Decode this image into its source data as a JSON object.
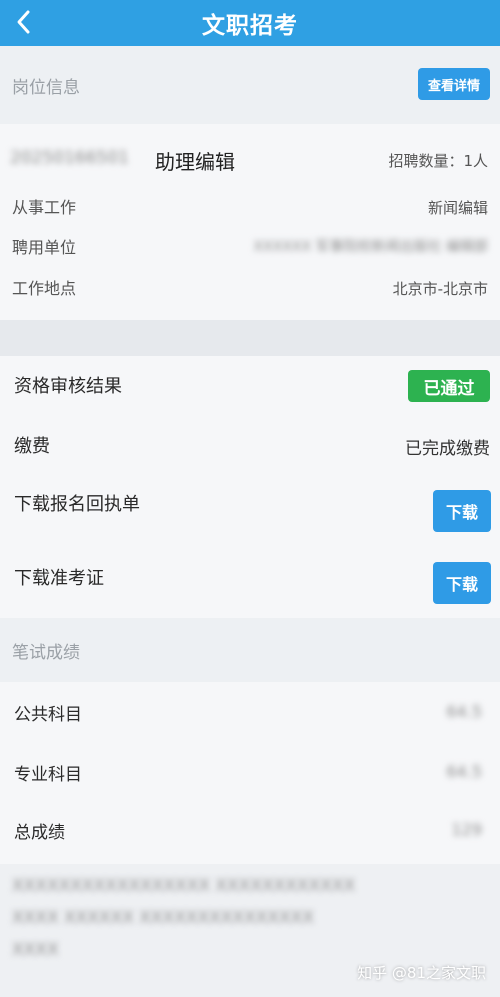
{
  "header": {
    "title": "文职招考",
    "back_icon": "chevron-left-icon"
  },
  "position_section": {
    "title": "岗位信息",
    "details_button": "查看详情",
    "position_code": "20250166501",
    "position_name": "助理编辑",
    "recruit_count": "招聘数量：1人",
    "rows": [
      {
        "label": "从事工作",
        "value": "新闻编辑"
      },
      {
        "label": "聘用单位",
        "value": "XXXXXX 军事院校新闻出版社 编辑部"
      },
      {
        "label": "工作地点",
        "value": "北京市-北京市"
      }
    ]
  },
  "status_section": {
    "qualification": {
      "label": "资格审核结果",
      "badge": "已通过",
      "badge_color": "#2db250"
    },
    "payment": {
      "label": "缴费",
      "value": "已完成缴费"
    },
    "download_receipt": {
      "label": "下载报名回执单",
      "button": "下载"
    },
    "download_admission": {
      "label": "下载准考证",
      "button": "下载"
    }
  },
  "scores_section": {
    "title": "笔试成绩",
    "rows": [
      {
        "label": "公共科目",
        "value": "64.5"
      },
      {
        "label": "专业科目",
        "value": "64.5"
      },
      {
        "label": "总成绩",
        "value": "129"
      }
    ]
  },
  "footer_note": {
    "line1": "XXXXXXXXXXXXXXXXX XXXXXXXXXXXX",
    "line2": "XXXX XXXXXX XXXXXXXXXXXXXXX",
    "line3": "XXXX"
  },
  "watermark": "知乎 @81之家文职",
  "colors": {
    "header": "#2fa0e3",
    "button": "#2f9be6",
    "success": "#2db250"
  }
}
